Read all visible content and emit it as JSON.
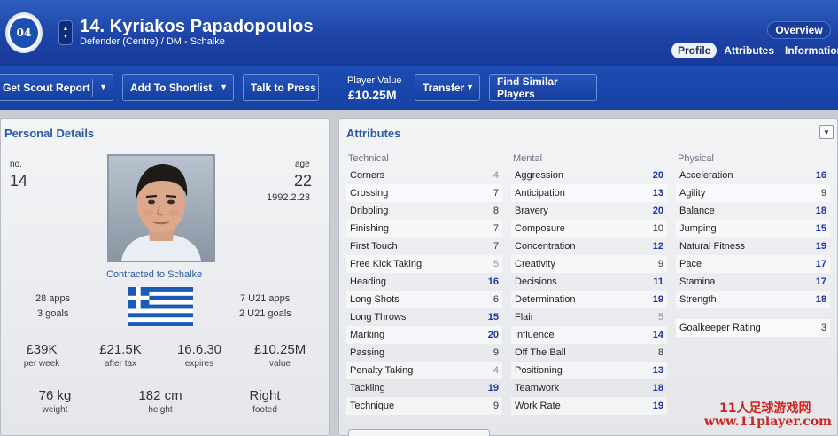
{
  "header": {
    "crest_text": "04",
    "player_name": "14. Kyriakos Papadopoulos",
    "player_sub": "Defender (Centre) / DM - Schalke",
    "overview_label": "Overview",
    "tabs": [
      {
        "label": "Profile",
        "active": true
      },
      {
        "label": "Attributes",
        "active": false
      },
      {
        "label": "Information",
        "active": false
      }
    ]
  },
  "actions": {
    "scout_label": "Get Scout Report",
    "shortlist_label": "Add To Shortlist",
    "press_label": "Talk to Press",
    "player_value_label": "Player Value",
    "player_value": "£10.25M",
    "transfer_label": "Transfer",
    "similar_label": "Find Similar Players"
  },
  "personal": {
    "title": "Personal Details",
    "no_label": "no.",
    "no_value": "14",
    "age_label": "age",
    "age_value": "22",
    "dob": "1992.2.23",
    "contract": "Contracted to Schalke",
    "apps": "28 apps",
    "goals": "3 goals",
    "u21_apps": "7 U21 apps",
    "u21_goals": "2 U21 goals",
    "wage_value": "£39K",
    "wage_label": "per week",
    "after_tax_value": "£21.5K",
    "after_tax_label": "after tax",
    "expires_value": "16.6.30",
    "expires_label": "expires",
    "value_value": "£10.25M",
    "value_label": "value",
    "weight_value": "76 kg",
    "weight_label": "weight",
    "height_value": "182 cm",
    "height_label": "height",
    "foot_value": "Right",
    "foot_label": "footed",
    "flag_colors": {
      "blue": "#1a5bb8",
      "white": "#ffffff"
    }
  },
  "attributes": {
    "title": "Attributes",
    "technical": {
      "heading": "Technical",
      "items": [
        {
          "name": "Corners",
          "value": "4"
        },
        {
          "name": "Crossing",
          "value": "7"
        },
        {
          "name": "Dribbling",
          "value": "8"
        },
        {
          "name": "Finishing",
          "value": "7"
        },
        {
          "name": "First Touch",
          "value": "7"
        },
        {
          "name": "Free Kick Taking",
          "value": "5"
        },
        {
          "name": "Heading",
          "value": "16"
        },
        {
          "name": "Long Shots",
          "value": "6"
        },
        {
          "name": "Long Throws",
          "value": "15"
        },
        {
          "name": "Marking",
          "value": "20"
        },
        {
          "name": "Passing",
          "value": "9"
        },
        {
          "name": "Penalty Taking",
          "value": "4"
        },
        {
          "name": "Tackling",
          "value": "19"
        },
        {
          "name": "Technique",
          "value": "9"
        }
      ]
    },
    "mental": {
      "heading": "Mental",
      "items": [
        {
          "name": "Aggression",
          "value": "20"
        },
        {
          "name": "Anticipation",
          "value": "13"
        },
        {
          "name": "Bravery",
          "value": "20"
        },
        {
          "name": "Composure",
          "value": "10"
        },
        {
          "name": "Concentration",
          "value": "12"
        },
        {
          "name": "Creativity",
          "value": "9"
        },
        {
          "name": "Decisions",
          "value": "11"
        },
        {
          "name": "Determination",
          "value": "19"
        },
        {
          "name": "Flair",
          "value": "5"
        },
        {
          "name": "Influence",
          "value": "14"
        },
        {
          "name": "Off The Ball",
          "value": "8"
        },
        {
          "name": "Positioning",
          "value": "13"
        },
        {
          "name": "Teamwork",
          "value": "18"
        },
        {
          "name": "Work Rate",
          "value": "19"
        }
      ]
    },
    "physical": {
      "heading": "Physical",
      "items": [
        {
          "name": "Acceleration",
          "value": "16"
        },
        {
          "name": "Agility",
          "value": "9"
        },
        {
          "name": "Balance",
          "value": "18"
        },
        {
          "name": "Jumping",
          "value": "15"
        },
        {
          "name": "Natural Fitness",
          "value": "19"
        },
        {
          "name": "Pace",
          "value": "17"
        },
        {
          "name": "Stamina",
          "value": "17"
        },
        {
          "name": "Strength",
          "value": "18"
        }
      ]
    },
    "goalkeeper_label": "Goalkeeper Rating",
    "goalkeeper_value": "3"
  },
  "watermark": {
    "line1": "11人足球游戏网",
    "line2": "www.11player.com"
  }
}
